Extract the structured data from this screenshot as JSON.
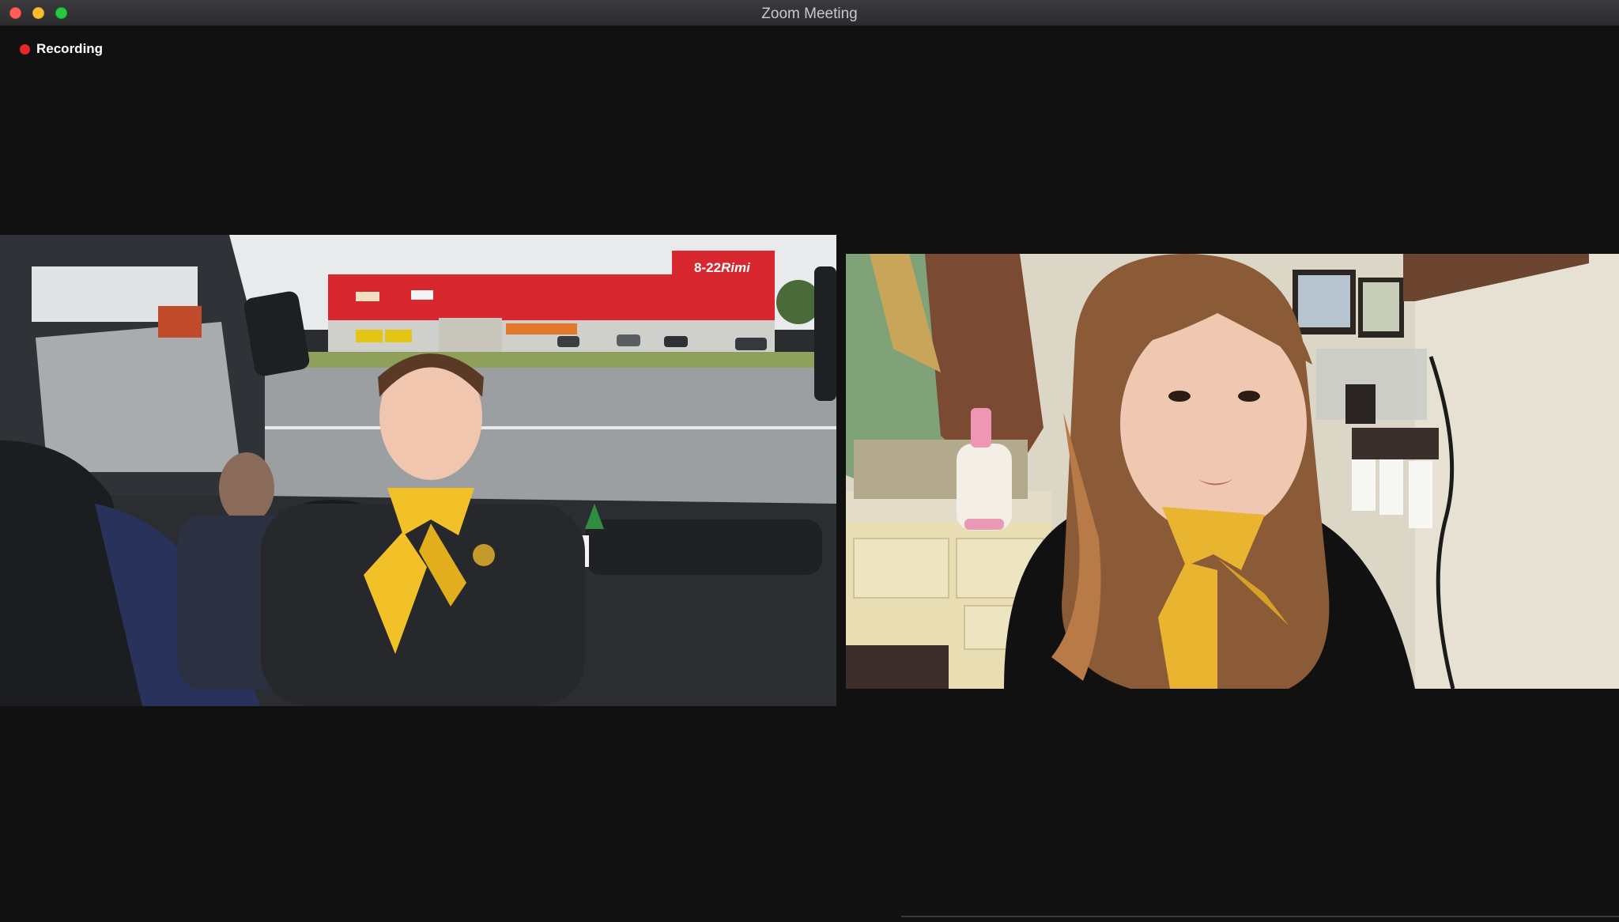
{
  "window": {
    "title": "Zoom Meeting"
  },
  "recording": {
    "label": "Recording",
    "indicator_color": "#e5262a"
  },
  "participants": [
    {
      "tile": "left",
      "scene": "bus-interior",
      "accent": "#f2c027"
    },
    {
      "tile": "right",
      "scene": "home-room",
      "accent": "#e9b531"
    }
  ],
  "scene_text": {
    "store_hours": "8-22",
    "store_name": "Rimi"
  },
  "colors": {
    "window_bg": "#111111",
    "titlebar": "#2c2c2e",
    "close": "#fe5f57",
    "minimize": "#febc2e",
    "maximize": "#28c840"
  }
}
